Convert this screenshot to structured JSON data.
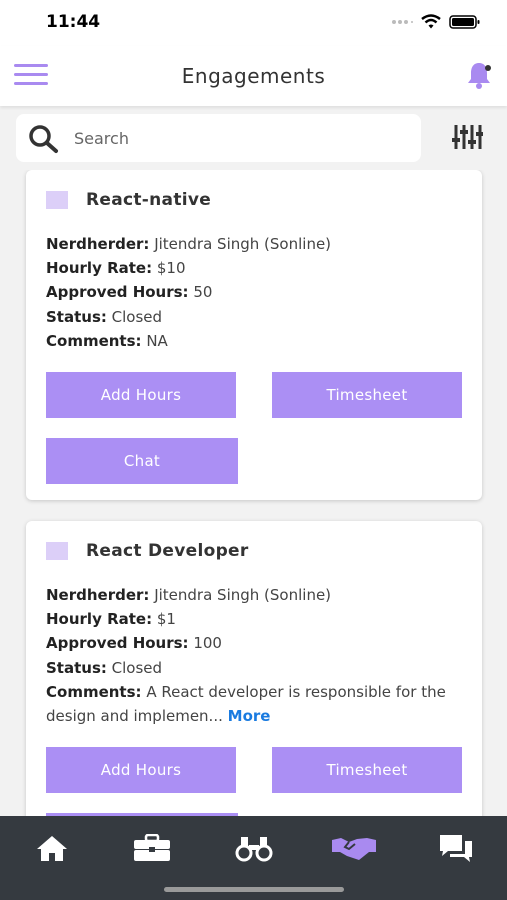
{
  "status": {
    "time": "11:44"
  },
  "header": {
    "title": "Engagements"
  },
  "search": {
    "placeholder": "Search"
  },
  "labels": {
    "nerdherder": "Nerdherder:",
    "hourly_rate": "Hourly Rate:",
    "approved_hours": "Approved Hours:",
    "status": "Status:",
    "comments": "Comments:"
  },
  "cards": [
    {
      "title": "React-native",
      "nerdherder": "Jitendra Singh (Sonline)",
      "hourly_rate": "$10",
      "approved_hours": "50",
      "status": "Closed",
      "comments": "NA",
      "buttons": {
        "add_hours": "Add Hours",
        "timesheet": "Timesheet",
        "chat": "Chat"
      }
    },
    {
      "title": "React Developer",
      "nerdherder": "Jitendra Singh (Sonline)",
      "hourly_rate": "$1",
      "approved_hours": "100",
      "status": "Closed",
      "comments": "A React developer is responsible for the design and implemen...",
      "more": "More",
      "buttons": {
        "add_hours": "Add Hours",
        "timesheet": "Timesheet"
      }
    }
  ],
  "tabs": [
    {
      "icon": "home-icon",
      "active": false
    },
    {
      "icon": "briefcase-icon",
      "active": false
    },
    {
      "icon": "binoculars-icon",
      "active": false
    },
    {
      "icon": "handshake-icon",
      "active": true
    },
    {
      "icon": "chat-bubbles-icon",
      "active": false
    }
  ],
  "colors": {
    "accent": "#ab8ff4",
    "tab_bar": "#353a40",
    "active_tab": "#a98af0",
    "link": "#1a7be0"
  }
}
